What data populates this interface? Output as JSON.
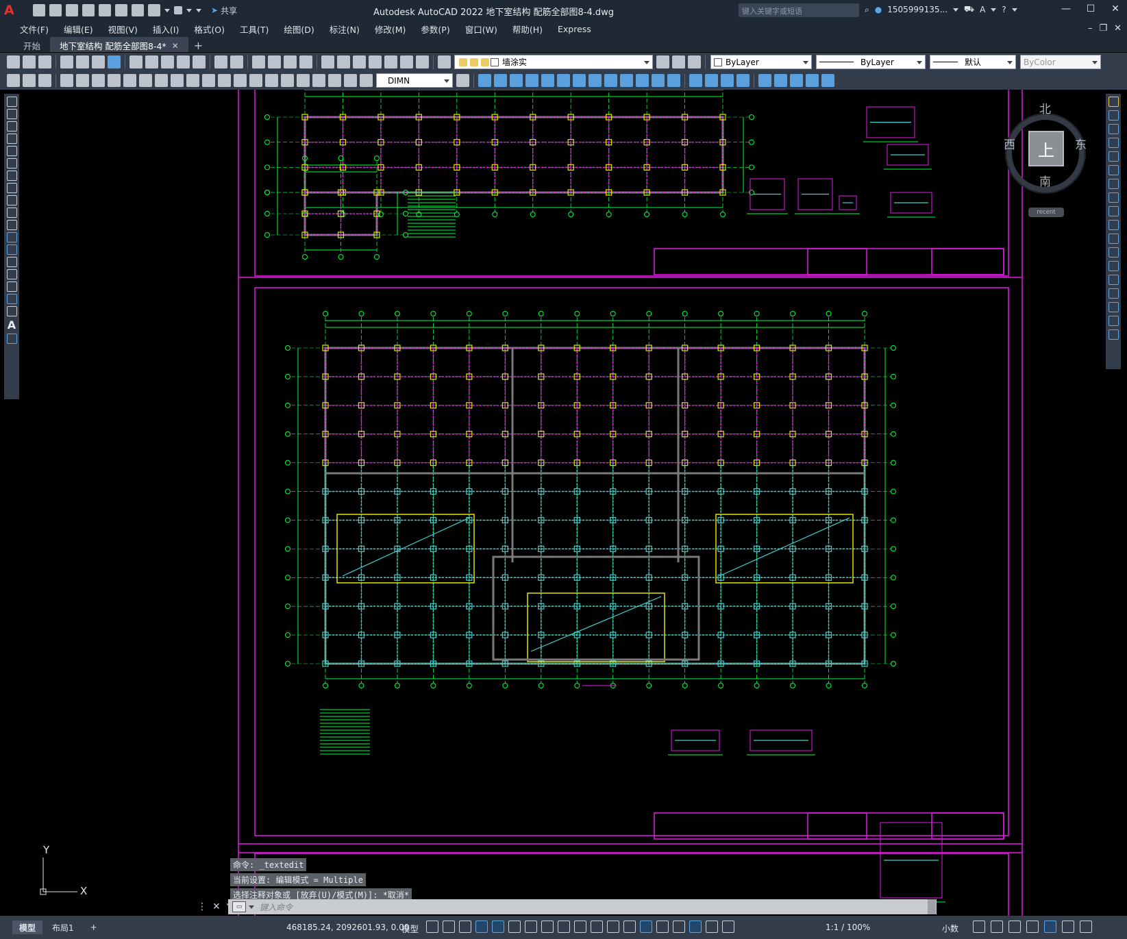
{
  "app": {
    "logo": "A",
    "title": "Autodesk AutoCAD 2022    地下室结构 配筋全部图8-4.dwg",
    "share_label": "共享",
    "search_placeholder": "键入关键字或短语",
    "user": "1505999135...",
    "help": "?"
  },
  "menu": [
    "文件(F)",
    "编辑(E)",
    "视图(V)",
    "插入(I)",
    "格式(O)",
    "工具(T)",
    "绘图(D)",
    "标注(N)",
    "修改(M)",
    "参数(P)",
    "窗口(W)",
    "帮助(H)",
    "Express"
  ],
  "tabs": [
    {
      "label": "开始",
      "active": false
    },
    {
      "label": "地下室结构 配筋全部图8-4*",
      "active": true
    }
  ],
  "toolbar": {
    "layer_value": "墙涂实",
    "color_value": "ByLayer",
    "linetype_value": "ByLayer",
    "lineweight_value": "默认",
    "plotstyle_value": "ByColor",
    "dimstyle_value": "DIMN"
  },
  "viewcube": {
    "north": "北",
    "south": "南",
    "east": "东",
    "west": "西",
    "face": "上",
    "recent": "recent"
  },
  "ucs": {
    "y_label": "Y",
    "x_label": "X"
  },
  "command": {
    "history": [
      "命令: _textedit",
      "当前设置: 编辑模式 = Multiple",
      "选择注释对象或 [放弃(U)/模式(M)]: *取消*"
    ],
    "placeholder": "键入命令"
  },
  "status": {
    "layout_tabs": [
      "模型",
      "布局1"
    ],
    "active_layout": "模型",
    "coordinates": "468185.24, 2092601.93, 0.00",
    "space": "模型",
    "annotation_scale": "1:1 / 100%",
    "units": "小数"
  },
  "colors": {
    "frame": "#e619e6",
    "grid_green": "#00ff3c",
    "cyan": "#3fd0d0",
    "wall": "#7a7a7a",
    "yellow": "#e6e600",
    "ui_dark": "#1f2936",
    "toolbar": "#333c4b"
  }
}
